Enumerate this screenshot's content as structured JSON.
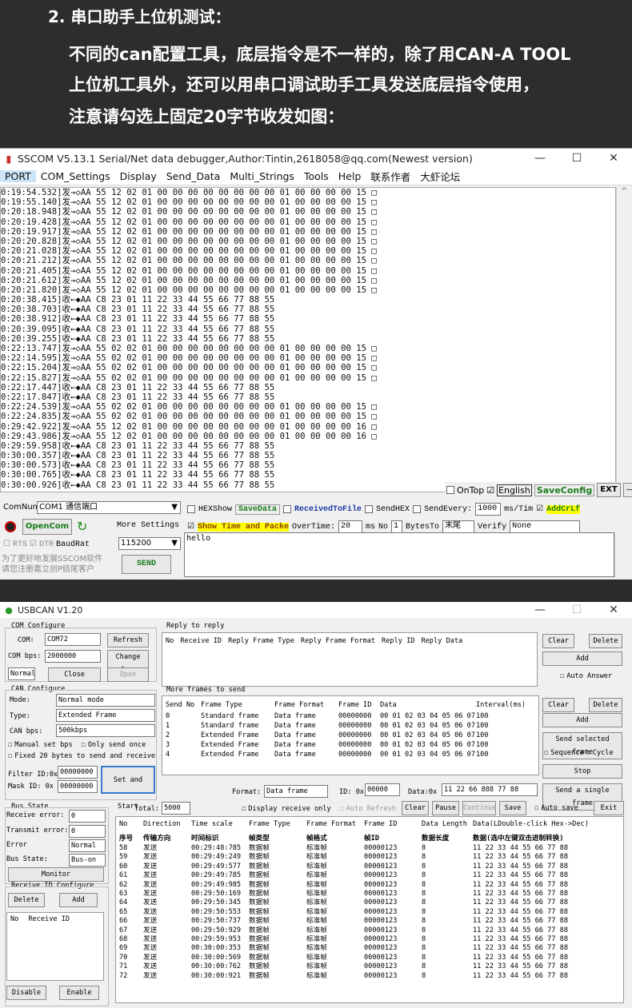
{
  "banner": {
    "heading": "2. 串口助手上位机测试：",
    "lines": [
      "不同的can配置工具，底层指令是不一样的，除了用CAN-A TOOL",
      "上位机工具外，还可以用串口调试助手工具发送底层指令使用，",
      "注意请勾选上固定20字节收发如图："
    ]
  },
  "sscom": {
    "title": "SSCOM V5.13.1 Serial/Net data debugger,Author:Tintin,2618058@qq.com(Newest version)",
    "menu": [
      "PORT",
      "COM_Settings",
      "Display",
      "Send_Data",
      "Multi_Strings",
      "Tools",
      "Help",
      "联系作者",
      "大虾论坛"
    ],
    "log": [
      "0:19:54.532]发→◇AA 55 12 02 01 00 00 00 00 00 00 00 00 01 00 00 00 00 15 □",
      "0:19:55.140]发→◇AA 55 12 02 01 00 00 00 00 00 00 00 00 01 00 00 00 00 15 □",
      "0:20:18.948]发→◇AA 55 12 02 01 00 00 00 00 00 00 00 00 01 00 00 00 00 15 □",
      "0:20:19.428]发→◇AA 55 12 02 01 00 00 00 00 00 00 00 00 01 00 00 00 00 15 □",
      "0:20:19.917]发→◇AA 55 12 02 01 00 00 00 00 00 00 00 00 01 00 00 00 00 15 □",
      "0:20:20.828]发→◇AA 55 12 02 01 00 00 00 00 00 00 00 00 01 00 00 00 00 15 □",
      "0:20:21.028]发→◇AA 55 12 02 01 00 00 00 00 00 00 00 00 01 00 00 00 00 15 □",
      "0:20:21.212]发→◇AA 55 12 02 01 00 00 00 00 00 00 00 00 01 00 00 00 00 15 □",
      "0:20:21.405]发→◇AA 55 12 02 01 00 00 00 00 00 00 00 00 01 00 00 00 00 15 □",
      "0:20:21.612]发→◇AA 55 12 02 01 00 00 00 00 00 00 00 00 01 00 00 00 00 15 □",
      "0:20:21.820]发→◇AA 55 12 02 01 00 00 00 00 00 00 00 00 01 00 00 00 00 15 □",
      "0:20:38.415]收←◆AA C8 23 01 11 22 33 44 55 66 77 88 55",
      "0:20:38.703]收←◆AA C8 23 01 11 22 33 44 55 66 77 88 55",
      "0:20:38.912]收←◆AA C8 23 01 11 22 33 44 55 66 77 88 55",
      "0:20:39.095]收←◆AA C8 23 01 11 22 33 44 55 66 77 88 55",
      "0:20:39.255]收←◆AA C8 23 01 11 22 33 44 55 66 77 88 55",
      "0:22:13.747]发→◇AA 55 02 02 01 00 00 00 00 00 00 00 00 01 00 00 00 00 15 □",
      "0:22:14.595]发→◇AA 55 02 02 01 00 00 00 00 00 00 00 00 01 00 00 00 00 15 □",
      "0:22:15.204]发→◇AA 55 02 02 01 00 00 00 00 00 00 00 00 01 00 00 00 00 15 □",
      "0:22:15.827]发→◇AA 55 02 02 01 00 00 00 00 00 00 00 00 01 00 00 00 00 15 □",
      "0:22:17.447]收←◆AA C8 23 01 11 22 33 44 55 66 77 88 55",
      "0:22:17.847]收←◆AA C8 23 01 11 22 33 44 55 66 77 88 55",
      "0:22:24.539]发→◇AA 55 02 02 01 00 00 00 00 00 00 00 00 01 00 00 00 00 15 □",
      "0:22:24.835]发→◇AA 55 02 02 01 00 00 00 00 00 00 00 00 01 00 00 00 00 15 □",
      "0:29:42.922]发→◇AA 55 12 02 01 00 00 00 00 00 00 00 00 01 00 00 00 00 16 □",
      "0:29:43.986]发→◇AA 55 12 02 01 00 00 00 00 00 00 00 00 01 00 00 00 00 16 □",
      "0:29:59.958]收←◆AA C8 23 01 11 22 33 44 55 66 77 88 55",
      "0:30:00.357]收←◆AA C8 23 01 11 22 33 44 55 66 77 88 55",
      "0:30:00.573]收←◆AA C8 23 01 11 22 33 44 55 66 77 88 55",
      "0:30:00.765]收←◆AA C8 23 01 11 22 33 44 55 66 77 88 55",
      "0:30:00.926]收←◆AA C8 23 01 11 22 33 44 55 66 77 88 55"
    ],
    "ontop": "OnTop",
    "english": "English",
    "saveconfig": "SaveConfig",
    "ext": "EXT",
    "comnum_label": "ComNum",
    "comnum_value": "COM1 通信端口",
    "hexshow": "HEXShow",
    "savedata": "SaveData",
    "recv_to_file": "ReceivedToFile",
    "sendhex": "SendHEX",
    "sendevery": "SendEvery:",
    "sendevery_value": "1000",
    "ms_tim": "ms/Tim",
    "addcrlf": "AddCrLf",
    "opencom": "OpenCom",
    "more_settings": "More Settings",
    "show_time": "Show Time and Packe",
    "overtime": "OverTime:",
    "overtime_value": "20",
    "ms": "ms",
    "no": "No",
    "no_value": "1",
    "bytes_to": "BytesTo",
    "bytes_to_value": "末尾",
    "verify": "Verify",
    "verify_value": "None",
    "rts": "RTS",
    "dtr": "DTR",
    "baudrate": "BaudRat",
    "baudrate_value": "115200",
    "send_text": "hello",
    "promo_1": "为了更好地发展SSCOM软件",
    "promo_2": "请您注册嘉立创P结尾客户",
    "send_btn": "SEND"
  },
  "usbcan": {
    "title": "USBCAN V1.20",
    "com_config": "COM Configure",
    "com_label": "COM:",
    "com_value": "COM72",
    "refresh": "Refresh",
    "combps_label": "COM bps:",
    "combps_value": "2000000",
    "change_bps": "Change bps",
    "normal": "Normal",
    "close": "Close",
    "open": "Open",
    "reply_to_reply": "Reply to reply",
    "reply_cols": [
      "No",
      "Receive ID",
      "Reply Frame Type",
      "Reply Frame Format",
      "Reply  ID",
      "Reply Data"
    ],
    "clear": "Clear",
    "delete": "Delete",
    "add": "Add",
    "auto_answer": "Auto Answer",
    "can_config": "CAN Configure",
    "mode_label": "Mode:",
    "mode_value": "Normal mode",
    "type_label": "Type:",
    "type_value": "Extended Frame",
    "canbps_label": "CAN bps:",
    "canbps_value": "500kbps",
    "manual_set_bps": "Manual set bps",
    "only_send_once": "Only send once",
    "fixed20": "Fixed 20 bytes to send and receive",
    "filter_id": "Filter ID:0x",
    "filter_value": "00000000",
    "mask_id": "Mask ID:  0x",
    "mask_value": "00000000",
    "set_and_start": "Set and Start",
    "more_frames": "More frames to send",
    "send_cols": [
      "Send No",
      "Frame Type",
      "Frame Format",
      "Frame ID",
      "Data",
      "Interval(ms)"
    ],
    "send_rows": [
      [
        "0",
        "Standard frame",
        "Data frame",
        "00000000",
        "00 01 02 03 04 05 06 07",
        "100"
      ],
      [
        "1",
        "Standard frame",
        "Data frame",
        "00000000",
        "00 01 02 03 04 05 06 07",
        "100"
      ],
      [
        "2",
        "Extended Frame",
        "Data frame",
        "00000000",
        "00 01 02 03 04 05 06 07",
        "100"
      ],
      [
        "3",
        "Extended Frame",
        "Data frame",
        "00000000",
        "00 01 02 03 04 05 06 07",
        "100"
      ],
      [
        "4",
        "Extended Frame",
        "Data frame",
        "00000000",
        "00 01 02 03 04 05 06 07",
        "100"
      ]
    ],
    "send_selected": "Send selected frame",
    "sequence": "Sequence",
    "cycle": "Cycle",
    "stop": "Stop",
    "format_label": "Format:",
    "format_value": "Data frame",
    "id_label": "ID: 0x",
    "id_value": "00000",
    "data_label": "Data:0x",
    "data_value": "11 22 66 888 77 88",
    "send_single": "Send a single frame",
    "bus_state": "Bus State",
    "receive_error": "Receive error:",
    "receive_error_value": "0",
    "transmit_error": "Transmit error:",
    "transmit_error_value": "0",
    "error": "Error",
    "error_value": "Normal",
    "bus_state_label": "Bus State:",
    "bus_state_value": "Bus-on",
    "monitor": "Monitor",
    "recv_id_config": "Receive ID Configure",
    "recv_id_cols": [
      "No",
      "Receive ID"
    ],
    "disable": "Disable",
    "enable": "Enable",
    "total_label": "Total:",
    "total_value": "5000",
    "display_recv_only": "Display receive only",
    "auto_refresh": "Auto Refresh",
    "pause": "Pause",
    "continue": "Continue",
    "save": "Save",
    "auto_save": "Auto save",
    "exit": "Exit",
    "log_cols_en": [
      "No",
      "Direction",
      "Time scale",
      "Frame Type",
      "Frame Format",
      "Frame ID",
      "Data Length",
      "Data(LDouble-click Hex->Dec)"
    ],
    "log_cols_cn": [
      "序号",
      "传输方向",
      "时间标识",
      "帧类型",
      "帧格式",
      "帧ID",
      "数据长度",
      "数据(选中左键双击进制转换)"
    ],
    "log_rows": [
      [
        "58",
        "发送",
        "00:29:48:785",
        "数据帧",
        "标准帧",
        "00000123",
        "8",
        "11 22 33 44 55 66 77 88"
      ],
      [
        "59",
        "发送",
        "00:29:49:249",
        "数据帧",
        "标准帧",
        "00000123",
        "8",
        "11 22 33 44 55 66 77 88"
      ],
      [
        "60",
        "发送",
        "00:29:49:577",
        "数据帧",
        "标准帧",
        "00000123",
        "8",
        "11 22 33 44 55 66 77 88"
      ],
      [
        "61",
        "发送",
        "00:29:49:785",
        "数据帧",
        "标准帧",
        "00000123",
        "8",
        "11 22 33 44 55 66 77 88"
      ],
      [
        "62",
        "发送",
        "00:29:49:985",
        "数据帧",
        "标准帧",
        "00000123",
        "8",
        "11 22 33 44 55 66 77 88"
      ],
      [
        "63",
        "发送",
        "00:29:50:169",
        "数据帧",
        "标准帧",
        "00000123",
        "8",
        "11 22 33 44 55 66 77 88"
      ],
      [
        "64",
        "发送",
        "00:29:50:345",
        "数据帧",
        "标准帧",
        "00000123",
        "8",
        "11 22 33 44 55 66 77 88"
      ],
      [
        "65",
        "发送",
        "00:29:50:553",
        "数据帧",
        "标准帧",
        "00000123",
        "8",
        "11 22 33 44 55 66 77 88"
      ],
      [
        "66",
        "发送",
        "00:29:50:737",
        "数据帧",
        "标准帧",
        "00000123",
        "8",
        "11 22 33 44 55 66 77 88"
      ],
      [
        "67",
        "发送",
        "00:29:50:929",
        "数据帧",
        "标准帧",
        "00000123",
        "8",
        "11 22 33 44 55 66 77 88"
      ],
      [
        "68",
        "发送",
        "00:29:59:953",
        "数据帧",
        "标准帧",
        "00000123",
        "8",
        "11 22 33 44 55 66 77 88"
      ],
      [
        "69",
        "发送",
        "00:30:00:353",
        "数据帧",
        "标准帧",
        "00000123",
        "8",
        "11 22 33 44 55 66 77 88"
      ],
      [
        "70",
        "发送",
        "00:30:00:569",
        "数据帧",
        "标准帧",
        "00000123",
        "8",
        "11 22 33 44 55 66 77 88"
      ],
      [
        "71",
        "发送",
        "00:30:00:762",
        "数据帧",
        "标准帧",
        "00000123",
        "8",
        "11 22 33 44 55 66 77 88"
      ],
      [
        "72",
        "发送",
        "00:30:00:921",
        "数据帧",
        "标准帧",
        "00000123",
        "8",
        "11 22 33 44 55 66 77 88"
      ]
    ]
  }
}
